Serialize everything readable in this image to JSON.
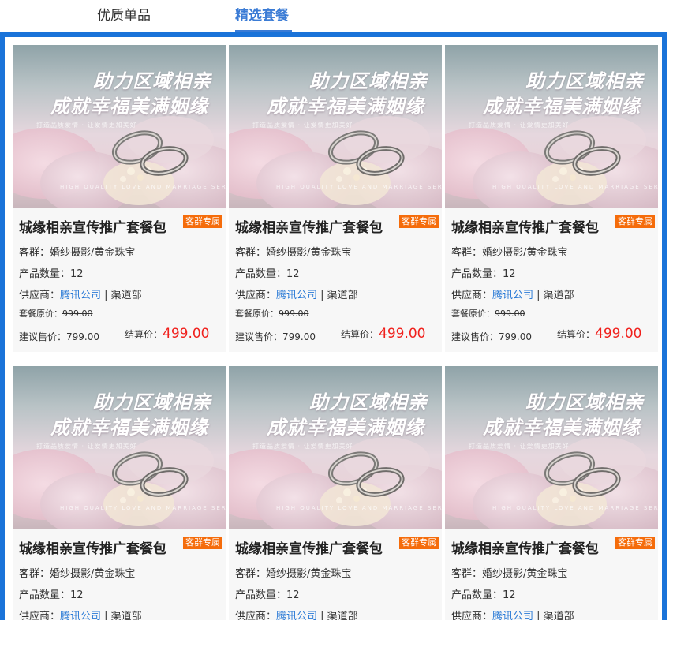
{
  "tabs": [
    {
      "label": "优质单品",
      "active": false
    },
    {
      "label": "精选套餐",
      "active": true
    }
  ],
  "colors": {
    "accent": "#3a7bd5",
    "frame": "#1a73d9",
    "badge": "#f56c0b",
    "price": "#f0201c",
    "link": "#2a7ad6"
  },
  "cards": [
    {
      "image": {
        "line1": "助力区域相亲",
        "line2": "成就幸福美满姻缘",
        "small": "打造品质爱情 · 让爱情更加美好",
        "bottom": "HIGH QUALITY LOVE AND MARRIAGE SERVICE"
      },
      "title": "城缘相亲宣传推广套餐包",
      "badge": "客群专属",
      "audience_label": "客群：",
      "audience": "婚纱摄影/黄金珠宝",
      "qty_label": "产品数量：",
      "qty": "12",
      "supplier_label": "供应商：",
      "supplier": "腾讯公司",
      "dept": " | 渠道部",
      "orig_label": "套餐原价：",
      "orig_price": "999.00",
      "suggest_label": "建议售价：",
      "suggest_price": "799.00",
      "settle_label": "结算价：",
      "settle_price": "499.00"
    },
    {
      "image": {
        "line1": "助力区域相亲",
        "line2": "成就幸福美满姻缘",
        "small": "打造品质爱情 · 让爱情更加美好",
        "bottom": "HIGH QUALITY LOVE AND MARRIAGE SERVICE"
      },
      "title": "城缘相亲宣传推广套餐包",
      "badge": "客群专属",
      "audience_label": "客群：",
      "audience": "婚纱摄影/黄金珠宝",
      "qty_label": "产品数量：",
      "qty": "12",
      "supplier_label": "供应商：",
      "supplier": "腾讯公司",
      "dept": " | 渠道部",
      "orig_label": "套餐原价：",
      "orig_price": "999.00",
      "suggest_label": "建议售价：",
      "suggest_price": "799.00",
      "settle_label": "结算价：",
      "settle_price": "499.00"
    },
    {
      "image": {
        "line1": "助力区域相亲",
        "line2": "成就幸福美满姻缘",
        "small": "打造品质爱情 · 让爱情更加美好",
        "bottom": "HIGH QUALITY LOVE AND MARRIAGE SERVICE"
      },
      "title": "城缘相亲宣传推广套餐包",
      "badge": "客群专属",
      "audience_label": "客群：",
      "audience": "婚纱摄影/黄金珠宝",
      "qty_label": "产品数量：",
      "qty": "12",
      "supplier_label": "供应商：",
      "supplier": "腾讯公司",
      "dept": " | 渠道部",
      "orig_label": "套餐原价：",
      "orig_price": "999.00",
      "suggest_label": "建议售价：",
      "suggest_price": "799.00",
      "settle_label": "结算价：",
      "settle_price": "499.00"
    },
    {
      "image": {
        "line1": "助力区域相亲",
        "line2": "成就幸福美满姻缘",
        "small": "打造品质爱情 · 让爱情更加美好",
        "bottom": "HIGH QUALITY LOVE AND MARRIAGE SERVICE"
      },
      "title": "城缘相亲宣传推广套餐包",
      "badge": "客群专属",
      "audience_label": "客群：",
      "audience": "婚纱摄影/黄金珠宝",
      "qty_label": "产品数量：",
      "qty": "12",
      "supplier_label": "供应商：",
      "supplier": "腾讯公司",
      "dept": " | 渠道部"
    },
    {
      "image": {
        "line1": "助力区域相亲",
        "line2": "成就幸福美满姻缘",
        "small": "打造品质爱情 · 让爱情更加美好",
        "bottom": "HIGH QUALITY LOVE AND MARRIAGE SERVICE"
      },
      "title": "城缘相亲宣传推广套餐包",
      "badge": "客群专属",
      "audience_label": "客群：",
      "audience": "婚纱摄影/黄金珠宝",
      "qty_label": "产品数量：",
      "qty": "12",
      "supplier_label": "供应商：",
      "supplier": "腾讯公司",
      "dept": " | 渠道部"
    },
    {
      "image": {
        "line1": "助力区域相亲",
        "line2": "成就幸福美满姻缘",
        "small": "打造品质爱情 · 让爱情更加美好",
        "bottom": "HIGH QUALITY LOVE AND MARRIAGE SERVICE"
      },
      "title": "城缘相亲宣传推广套餐包",
      "badge": "客群专属",
      "audience_label": "客群：",
      "audience": "婚纱摄影/黄金珠宝",
      "qty_label": "产品数量：",
      "qty": "12",
      "supplier_label": "供应商：",
      "supplier": "腾讯公司",
      "dept": " | 渠道部"
    }
  ]
}
